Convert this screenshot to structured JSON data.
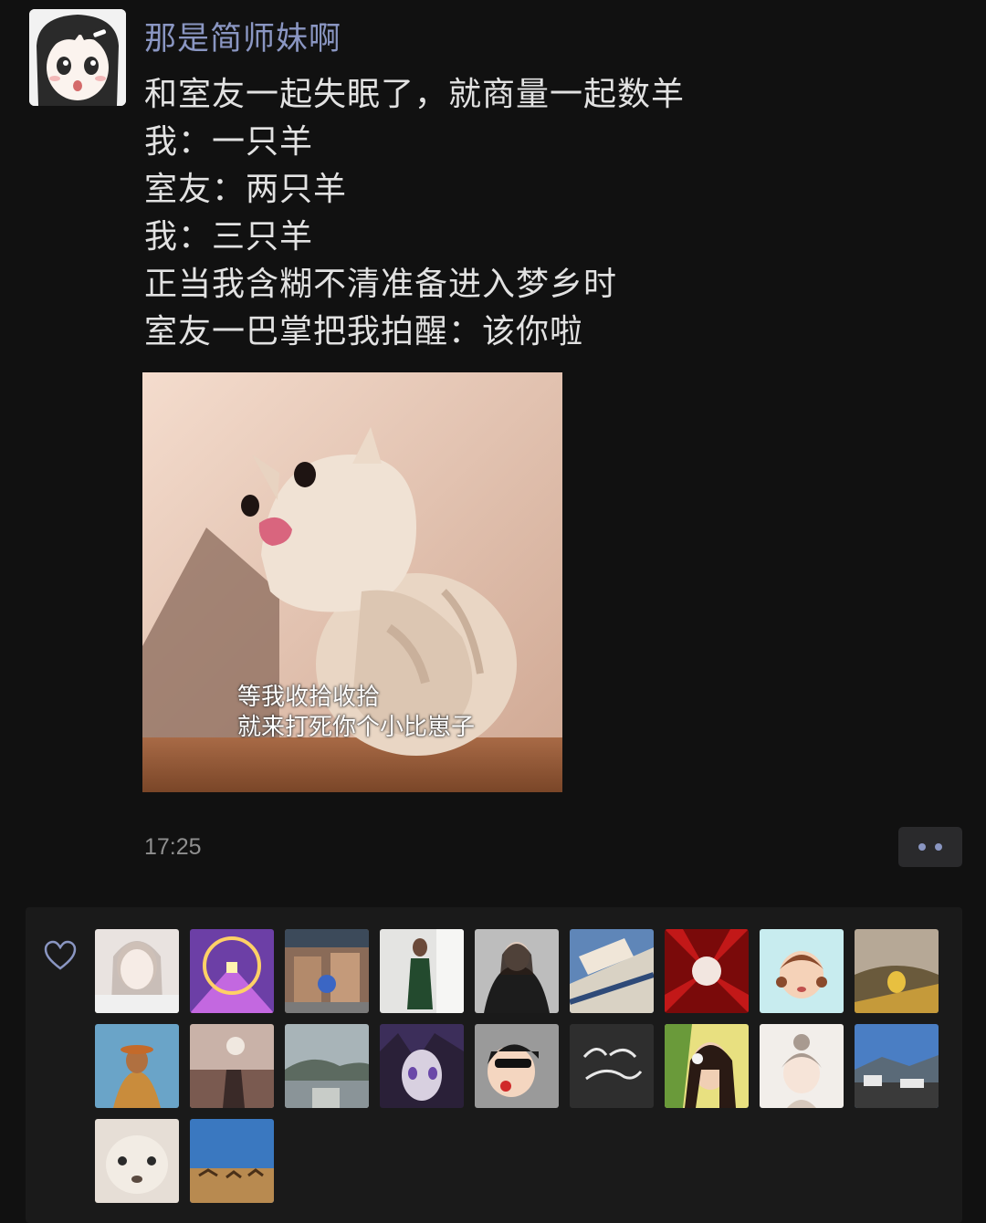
{
  "post": {
    "author": "那是简师妹啊",
    "lines": [
      "和室友一起失眠了，就商量一起数羊",
      "我：一只羊",
      "室友：两只羊",
      "我：三只羊",
      "正当我含糊不清准备进入梦乡时",
      "室友一巴掌把我拍醒：该你啦"
    ],
    "image_caption": {
      "line1": "等我收拾收拾",
      "line2": "就来打死你个小比崽子"
    },
    "time": "17:25"
  },
  "icons": {
    "like": "heart-icon",
    "more": "more-dots-icon"
  },
  "colors": {
    "background": "#111111",
    "author": "#8a96c2",
    "text": "#e2e2e2",
    "timestamp": "#8f8f8f",
    "likes_panel": "#1a1a1a"
  },
  "likes": {
    "count_shown": 20,
    "avatars": [
      {
        "name": "liker-avatar-1"
      },
      {
        "name": "liker-avatar-2"
      },
      {
        "name": "liker-avatar-3"
      },
      {
        "name": "liker-avatar-4"
      },
      {
        "name": "liker-avatar-5"
      },
      {
        "name": "liker-avatar-6"
      },
      {
        "name": "liker-avatar-7"
      },
      {
        "name": "liker-avatar-8"
      },
      {
        "name": "liker-avatar-9"
      },
      {
        "name": "liker-avatar-10"
      },
      {
        "name": "liker-avatar-11"
      },
      {
        "name": "liker-avatar-12"
      },
      {
        "name": "liker-avatar-13"
      },
      {
        "name": "liker-avatar-14"
      },
      {
        "name": "liker-avatar-15"
      },
      {
        "name": "liker-avatar-16"
      },
      {
        "name": "liker-avatar-17"
      },
      {
        "name": "liker-avatar-18"
      },
      {
        "name": "liker-avatar-19"
      },
      {
        "name": "liker-avatar-20"
      }
    ]
  }
}
